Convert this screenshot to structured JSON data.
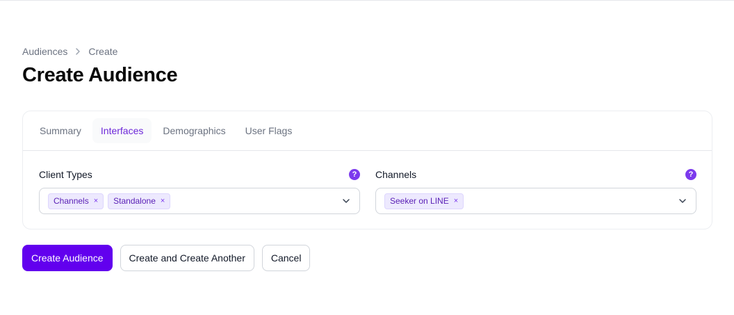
{
  "breadcrumb": {
    "parent": "Audiences",
    "current": "Create"
  },
  "page": {
    "title": "Create Audience"
  },
  "tabs": [
    {
      "label": "Summary"
    },
    {
      "label": "Interfaces"
    },
    {
      "label": "Demographics"
    },
    {
      "label": "User Flags"
    }
  ],
  "active_tab": "Interfaces",
  "client_types": {
    "label": "Client Types",
    "help": "?",
    "selected": [
      {
        "label": "Channels"
      },
      {
        "label": "Standalone"
      }
    ]
  },
  "channels": {
    "label": "Channels",
    "help": "?",
    "selected": [
      {
        "label": "Seeker on LINE"
      }
    ]
  },
  "chip_remove": "×",
  "actions": {
    "create": "Create Audience",
    "create_another": "Create and Create Another",
    "cancel": "Cancel"
  },
  "colors": {
    "accent": "#6200ee",
    "help": "#7c3aed",
    "chip_bg": "#ede9fe",
    "chip_text": "#5b21b6"
  }
}
